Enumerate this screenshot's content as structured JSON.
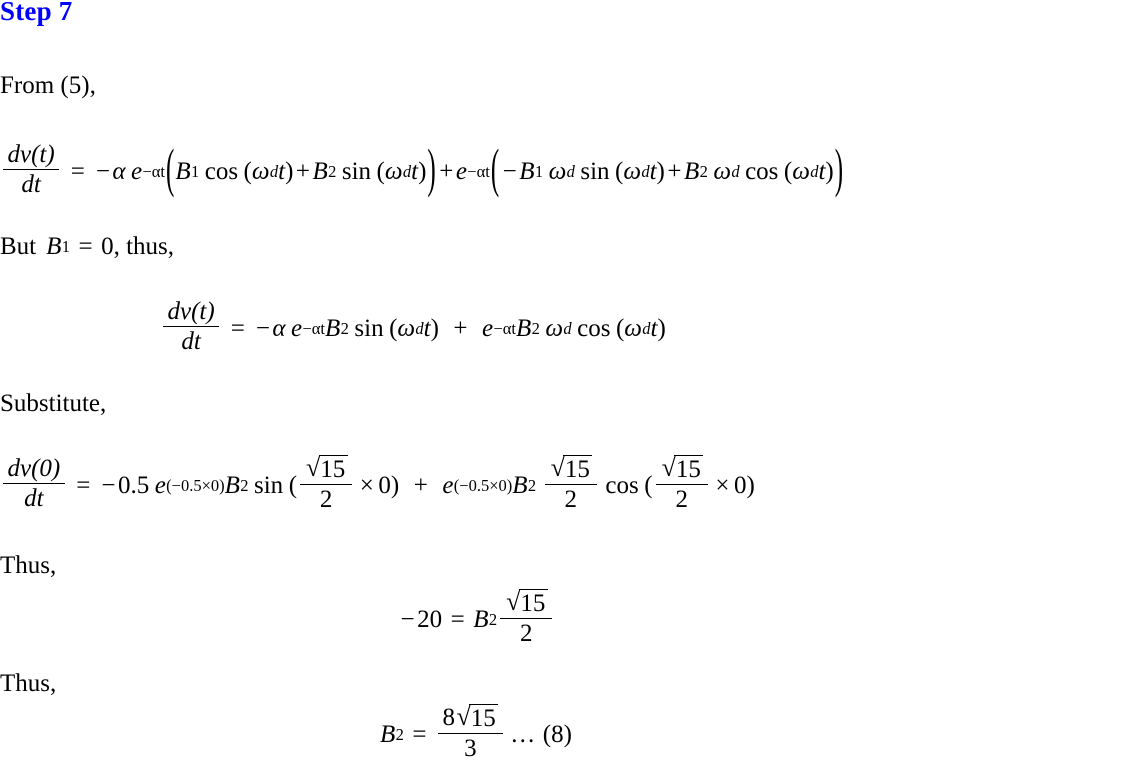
{
  "document": {
    "title": "Step 7",
    "title_color": "#0000ff",
    "background_color": "#ffffff",
    "text_color": "#000000"
  },
  "lines": {
    "from_reference": "From (5),",
    "but_condition_prefix": "But",
    "but_condition_math": "B",
    "but_condition_sub": "1",
    "but_condition_eq": "=",
    "but_condition_value": "0, thus,",
    "substitute": "Substitute,",
    "thus_1": "Thus,",
    "thus_2": "Thus,"
  },
  "equations": {
    "eq1": {
      "lhs_num": "dv(t)",
      "lhs_den": "dt",
      "eq_sign": "=",
      "minus": "−",
      "alpha": "α",
      "e": "e",
      "exp_minus_alpha_t": "−αt",
      "open_paren": "(",
      "close_paren": ")",
      "B": "B",
      "sub1": "1",
      "sub2": "2",
      "cos": "cos",
      "sin": "sin",
      "omega": "ω",
      "omega_sub": "d",
      "t": "t",
      "plus": "+",
      "full_text": "dv(t)/dt = -α e^(-αt)(B₁ cos(ω_d t) + B₂ sin(ω_d t)) + e^(-αt)(-B₁ ω_d sin(ω_d t) + B₂ ω_d cos(ω_d t))"
    },
    "eq2": {
      "full_text": "dv(t)/dt = -α e^(-αt) B₂ sin(ω_d t) + e^(-αt) B₂ ω_d cos(ω_d t)"
    },
    "eq3": {
      "lhs_num": "dv(0)",
      "lhs_den": "dt",
      "coefficient": "0.5",
      "exponent": "(−0.5×0)",
      "sqrt_radicand": "15",
      "frac_den": "2",
      "multiplier": "0",
      "full_text": "dv(0)/dt = -0.5 e^(-0.5×0) B₂ sin(√15/2 × 0) + e^(-0.5×0) B₂ √15/2 cos(√15/2 × 0)"
    },
    "eq4": {
      "lhs": "−20",
      "eq_sign": "=",
      "B": "B",
      "sub": "2",
      "sqrt_radicand": "15",
      "frac_den": "2",
      "full_text": "-20 = B₂ √15/2"
    },
    "eq5": {
      "B": "B",
      "sub": "2",
      "eq_sign": "=",
      "num_coefficient": "8",
      "sqrt_radicand": "15",
      "frac_den": "3",
      "dots": "…",
      "tag": "(8)",
      "full_text": "B₂ = 8√15/3 ... (8)"
    }
  },
  "symbols": {
    "minus": "−",
    "plus": "+",
    "equals": "=",
    "times": "×",
    "alpha": "α",
    "omega": "ω",
    "radical": "√",
    "ellipsis": "…",
    "lparen": "(",
    "rparen": ")"
  }
}
